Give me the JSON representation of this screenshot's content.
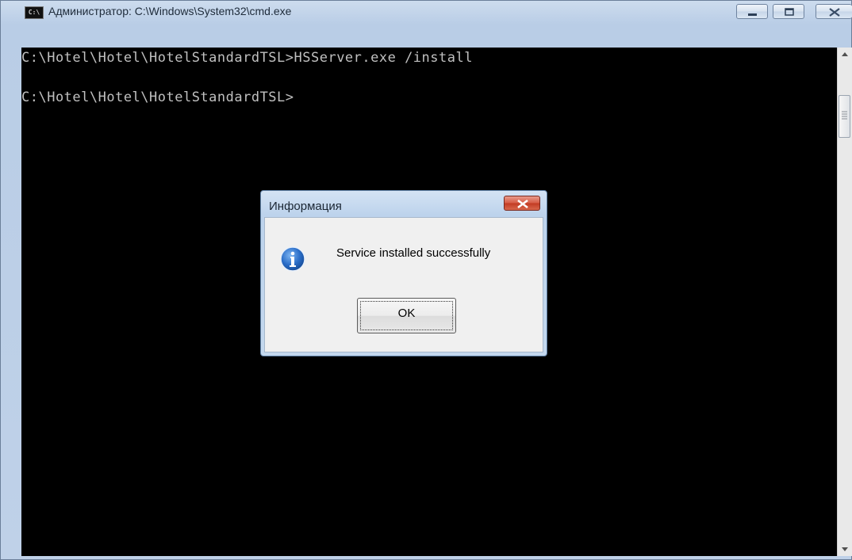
{
  "window": {
    "title": "Администратор: C:\\Windows\\System32\\cmd.exe",
    "icon_text": "C:\\",
    "controls": [
      "minimize-icon",
      "maximize-icon",
      "close-icon"
    ]
  },
  "console": {
    "lines": [
      "C:\\Hotel\\Hotel\\HotelStandardTSL>HSServer.exe /install",
      "C:\\Hotel\\Hotel\\HotelStandardTSL>"
    ],
    "background": "#000000",
    "foreground": "#c0c0c0"
  },
  "dialog": {
    "title": "Информация",
    "icon": "info-icon",
    "message": "Service installed successfully",
    "ok_label": "OK"
  }
}
